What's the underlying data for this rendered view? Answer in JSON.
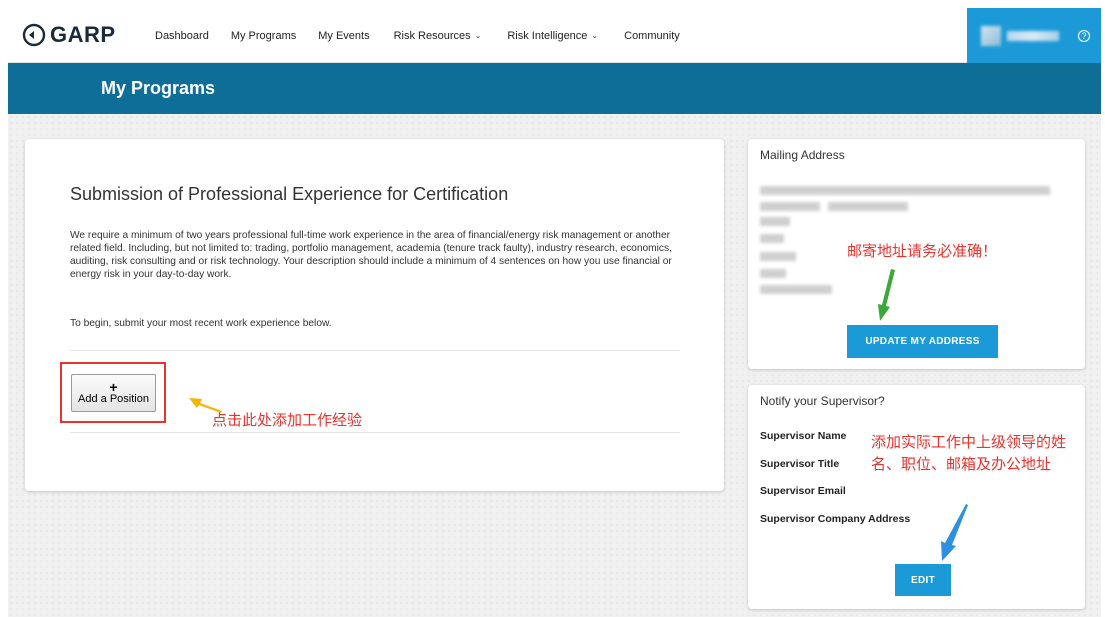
{
  "brand": {
    "logo_text": "GARP"
  },
  "nav": {
    "items": [
      {
        "label": "Dashboard",
        "has_caret": false
      },
      {
        "label": "My Programs",
        "has_caret": false
      },
      {
        "label": "My Events",
        "has_caret": false
      },
      {
        "label": "Risk Resources",
        "has_caret": true
      },
      {
        "label": "Risk Intelligence",
        "has_caret": true
      },
      {
        "label": "Community",
        "has_caret": false
      }
    ],
    "help_icon": "?"
  },
  "header": {
    "title": "My Programs"
  },
  "main": {
    "heading": "Submission of Professional Experience for Certification",
    "description": "We require a minimum of two years professional full-time work experience in the area of financial/energy risk management or another related field. Including, but not limited to: trading, portfolio management, academia (tenure track faulty), industry research, economics, auditing, risk consulting and or risk technology. Your description should include a minimum of 4 sentences on how you use financial or energy risk in your day-to-day work.",
    "begin_text": "To begin, submit your most recent work experience below.",
    "add_position": {
      "icon": "+",
      "label": "Add a Position"
    },
    "annotation": "点击此处添加工作经验"
  },
  "mailing": {
    "title": "Mailing Address",
    "annotation": "邮寄地址请务必准确！",
    "button": "UPDATE MY ADDRESS"
  },
  "supervisor": {
    "title": "Notify your Supervisor?",
    "fields": [
      "Supervisor Name",
      "Supervisor Title",
      "Supervisor Email",
      "Supervisor Company Address"
    ],
    "annotation": "添加实际工作中上级领导的姓名、职位、邮箱及办公地址",
    "button": "EDIT"
  },
  "colors": {
    "accent": "#1c9ad7",
    "header_bar": "#0e6e97",
    "annotation_red": "#e8332e",
    "arrow_yellow": "#f5b400",
    "arrow_green": "#3aa83a",
    "arrow_blue": "#2f8fe0"
  }
}
